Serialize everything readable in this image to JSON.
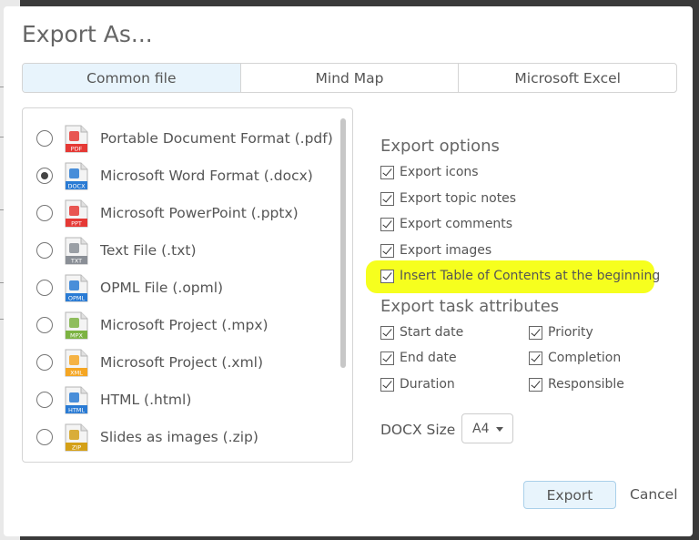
{
  "dialog": {
    "title": "Export As..."
  },
  "tabs": [
    {
      "label": "Common file",
      "active": true
    },
    {
      "label": "Mind Map",
      "active": false
    },
    {
      "label": "Microsoft Excel",
      "active": false
    }
  ],
  "formats": [
    {
      "label": "Portable Document Format (.pdf)",
      "icon_text": "PDF",
      "icon": "pdf-file-icon",
      "color": "#e53935",
      "selected": false
    },
    {
      "label": "Microsoft Word Format (.docx)",
      "icon_text": "DOCX",
      "icon": "docx-file-icon",
      "color": "#2a7bd4",
      "selected": true
    },
    {
      "label": "Microsoft PowerPoint (.pptx)",
      "icon_text": "PPT",
      "icon": "pptx-file-icon",
      "color": "#e53935",
      "selected": false
    },
    {
      "label": "Text File (.txt)",
      "icon_text": "TXT",
      "icon": "txt-file-icon",
      "color": "#8a8f96",
      "selected": false
    },
    {
      "label": "OPML File (.opml)",
      "icon_text": "OPML",
      "icon": "opml-file-icon",
      "color": "#2a7bd4",
      "selected": false
    },
    {
      "label": "Microsoft Project (.mpx)",
      "icon_text": "MPX",
      "icon": "mpx-file-icon",
      "color": "#7cb342",
      "selected": false
    },
    {
      "label": "Microsoft Project (.xml)",
      "icon_text": "XML",
      "icon": "xml-file-icon",
      "color": "#f5a623",
      "selected": false
    },
    {
      "label": "HTML (.html)",
      "icon_text": "HTML",
      "icon": "html-file-icon",
      "color": "#2a7bd4",
      "selected": false
    },
    {
      "label": "Slides as images (.zip)",
      "icon_text": "ZIP",
      "icon": "zip-file-icon",
      "color": "#d4a017",
      "selected": false
    }
  ],
  "export_options": {
    "title": "Export options",
    "items": [
      {
        "label": "Export icons",
        "checked": true
      },
      {
        "label": "Export topic notes",
        "checked": true
      },
      {
        "label": "Export comments",
        "checked": true
      },
      {
        "label": "Export images",
        "checked": true
      },
      {
        "label": "Insert Table of Contents at the beginning",
        "checked": true
      }
    ],
    "highlight_color": "#f6ff1e"
  },
  "task_attributes": {
    "title": "Export task attributes",
    "items": [
      {
        "label": "Start date",
        "checked": true
      },
      {
        "label": "Priority",
        "checked": true
      },
      {
        "label": "End date",
        "checked": true
      },
      {
        "label": "Completion",
        "checked": true
      },
      {
        "label": "Duration",
        "checked": true
      },
      {
        "label": "Responsible",
        "checked": true
      }
    ]
  },
  "docx_size": {
    "label": "DOCX Size",
    "value": "A4"
  },
  "buttons": {
    "export": "Export",
    "cancel": "Cancel"
  },
  "colors": {
    "accent_bg": "#e8f4fc",
    "accent_border": "#aad0ea"
  }
}
